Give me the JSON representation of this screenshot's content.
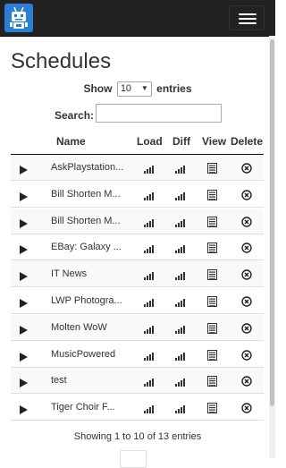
{
  "page": {
    "title": "Schedules"
  },
  "navbar": {
    "logo_icon": "robot-icon",
    "menu_icon": "hamburger-icon"
  },
  "length_control": {
    "prefix": "Show",
    "value": "10",
    "suffix": "entries"
  },
  "search": {
    "label": "Search:",
    "value": ""
  },
  "table": {
    "columns": {
      "name": "Name",
      "load": "Load",
      "diff": "Diff",
      "view": "View",
      "delete": "Delete"
    },
    "rows": [
      {
        "name": "AskPlaystation..."
      },
      {
        "name": "Bill Shorten M..."
      },
      {
        "name": "Bill Shorten M..."
      },
      {
        "name": "EBay: Galaxy ..."
      },
      {
        "name": "IT News"
      },
      {
        "name": "LWP Photogra..."
      },
      {
        "name": "Molten WoW"
      },
      {
        "name": "MusicPowered"
      },
      {
        "name": "test"
      },
      {
        "name": "Tiger Choir F..."
      }
    ],
    "icons": {
      "play": "play-icon",
      "load": "signal-icon",
      "diff": "signal-icon",
      "view": "list-icon",
      "delete": "delete-circle-icon"
    }
  },
  "footer": {
    "info": "Showing 1 to 10 of 13 entries"
  }
}
